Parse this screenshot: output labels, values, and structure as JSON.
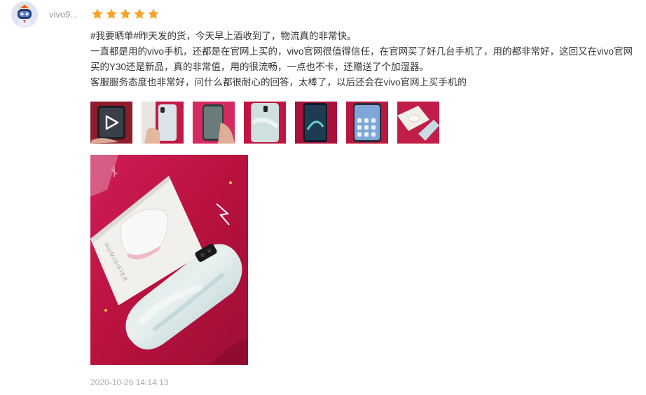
{
  "review": {
    "user": {
      "name": "vivo9...",
      "avatar_icon": "robot-avatar-icon"
    },
    "rating": {
      "value": 5,
      "max": 5,
      "star_color": "#f7a325"
    },
    "content": {
      "lines": [
        "#我要晒单#昨天发的货，今天早上酒收到了，物流真的非常快。",
        "一直都是用的vivo手机，还都是在官网上买的，vivo官网很值得信任，在官网买了好几台手机了，用的都非常好，这回又在vivo官网",
        "买的Y30还是新品，真的非常值，用的很流畅，一点也不卡，还赠送了个加湿器。",
        "客服服务态度也非常好，问什么都很耐心的回答，太棒了，以后还会在vivo官网上买手机的"
      ]
    },
    "media": {
      "thumbnails": [
        {
          "type": "video",
          "icon": "play-icon"
        },
        {
          "type": "image"
        },
        {
          "type": "image"
        },
        {
          "type": "image"
        },
        {
          "type": "image"
        },
        {
          "type": "image"
        },
        {
          "type": "image"
        }
      ],
      "preview": {
        "text": "HUMIDIFIER"
      }
    },
    "timestamp": "2020-10-26 14:14:13"
  }
}
